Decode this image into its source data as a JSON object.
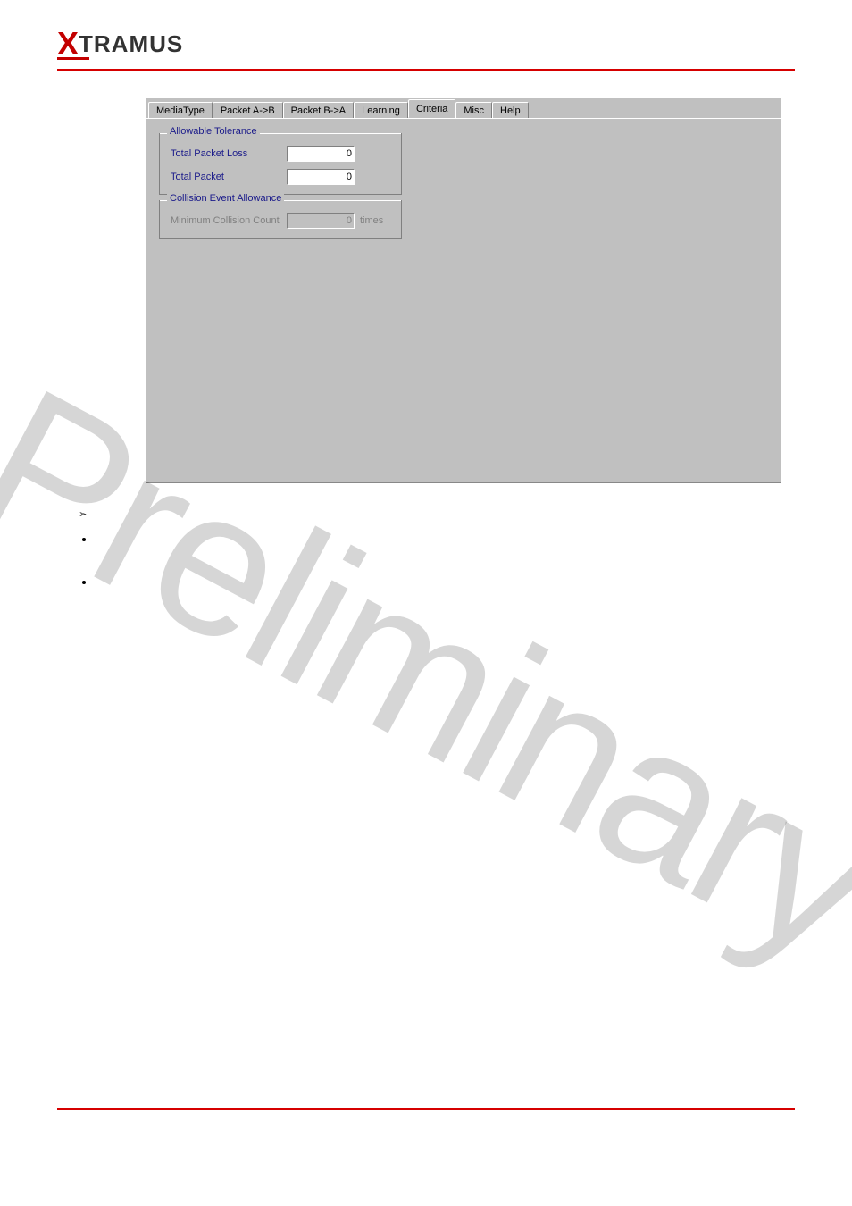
{
  "brand": {
    "x": "X",
    "rest": "TRAMUS"
  },
  "watermark": "Preliminary",
  "tabs": {
    "mediatype": "MediaType",
    "packet_ab": "Packet A->B",
    "packet_ba": "Packet B->A",
    "learning": "Learning",
    "criteria": "Criteria",
    "misc": "Misc",
    "help": "Help"
  },
  "group_tolerance": {
    "title": "Allowable Tolerance",
    "total_packet_loss_label": "Total Packet Loss",
    "total_packet_loss_value": "0",
    "total_packet_label": "Total Packet",
    "total_packet_value": "0"
  },
  "group_collision": {
    "title": "Collision Event Allowance",
    "min_collision_label": "Minimum Collision Count",
    "min_collision_value": "0",
    "min_collision_unit": "times"
  }
}
